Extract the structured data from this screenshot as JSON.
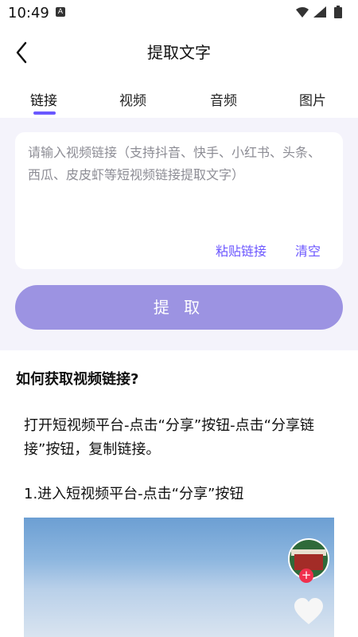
{
  "status": {
    "time": "10:49",
    "badge": "A"
  },
  "header": {
    "title": "提取文字"
  },
  "tabs": [
    {
      "label": "链接"
    },
    {
      "label": "视频"
    },
    {
      "label": "音频"
    },
    {
      "label": "图片"
    }
  ],
  "input": {
    "placeholder": "请输入视频链接（支持抖音、快手、小红书、头条、西瓜、皮皮虾等短视频链接提取文字）",
    "paste_label": "粘贴链接",
    "clear_label": "清空"
  },
  "extract_button": {
    "label": "提 取"
  },
  "guide": {
    "title": "如何获取视频链接?",
    "intro": "打开短视频平台-点击“分享”按钮-点击“分享链接”按钮，复制链接。",
    "step1": "1.进入短视频平台-点击“分享”按钮"
  },
  "colors": {
    "accent": "#6b56ff",
    "button": "#9c93e2",
    "panel_bg": "#f4f3fb"
  }
}
